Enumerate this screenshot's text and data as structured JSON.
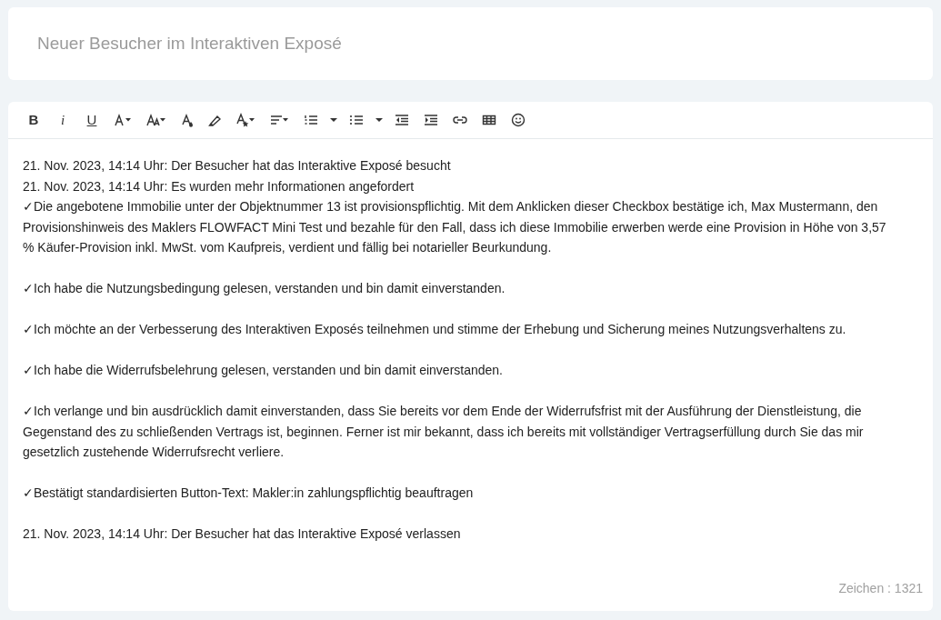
{
  "title_field": {
    "placeholder": "Neuer Besucher im Interaktiven Exposé"
  },
  "toolbar": [
    {
      "kind": "bold",
      "label": "B"
    },
    {
      "kind": "italic",
      "label": "i"
    },
    {
      "kind": "underline",
      "label": "U"
    },
    {
      "kind": "font-family"
    },
    {
      "kind": "font-size"
    },
    {
      "kind": "text-color"
    },
    {
      "kind": "highlight"
    },
    {
      "kind": "font-style"
    },
    {
      "kind": "align"
    },
    {
      "kind": "ordered-list"
    },
    {
      "kind": "dropdown"
    },
    {
      "kind": "bullet-list"
    },
    {
      "kind": "dropdown"
    },
    {
      "kind": "outdent"
    },
    {
      "kind": "indent"
    },
    {
      "kind": "link"
    },
    {
      "kind": "table"
    },
    {
      "kind": "emoji"
    }
  ],
  "blocks": [
    [
      "21. Nov. 2023, 14:14 Uhr: Der Besucher hat das Interaktive Exposé besucht",
      "21. Nov. 2023, 14:14 Uhr: Es wurden mehr Informationen angefordert",
      "✓Die angebotene Immobilie unter der Objektnummer 13 ist provisionspflichtig. Mit dem Anklicken dieser Checkbox bestätige ich, Max Mustermann, den Provisionshinweis des Maklers FLOWFACT Mini Test und bezahle für den Fall, dass ich diese Immobilie erwerben werde eine Provision in Höhe von 3,57 % Käufer-Provision inkl. MwSt. vom Kaufpreis, verdient und fällig bei notarieller Beurkundung."
    ],
    [
      "✓Ich habe die Nutzungsbedingung gelesen, verstanden und bin damit einverstanden."
    ],
    [
      "✓Ich möchte an der Verbesserung des Interaktiven Exposés teilnehmen und stimme der Erhebung und Sicherung meines Nutzungsverhaltens zu."
    ],
    [
      "✓Ich habe die Widerrufsbelehrung gelesen, verstanden und bin damit einverstanden."
    ],
    [
      "✓Ich verlange und bin ausdrücklich damit einverstanden, dass Sie bereits vor dem Ende der Widerrufsfrist mit der Ausführung der Dienstleistung, die Gegenstand des zu schließenden Vertrags ist, beginnen. Ferner ist mir bekannt, dass ich bereits mit vollständiger Vertragserfüllung durch Sie das mir gesetzlich zustehende Widerrufsrecht verliere."
    ],
    [
      "✓Bestätigt standardisierten Button-Text: Makler:in zahlungspflichtig beauftragen"
    ],
    [
      "21. Nov. 2023, 14:14 Uhr: Der Besucher hat das Interaktive Exposé verlassen"
    ]
  ],
  "char_count": "Zeichen : 1321"
}
